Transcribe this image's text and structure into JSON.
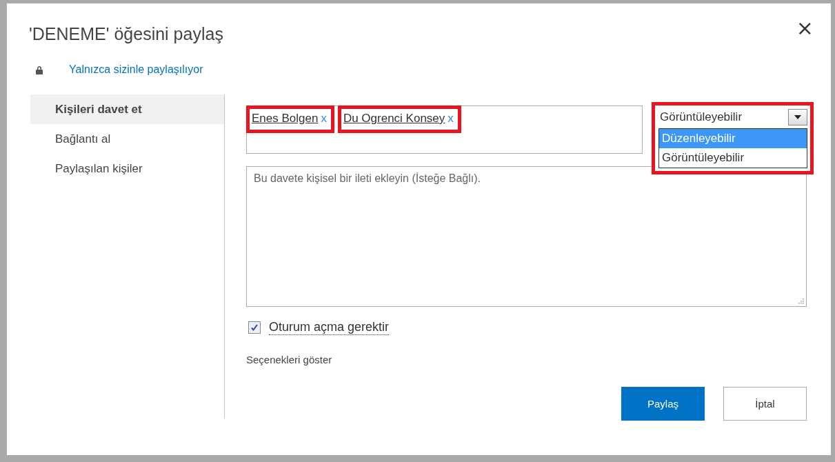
{
  "dialog": {
    "title": "'DENEME' öğesini paylaş",
    "close": "×",
    "sharing_status": "Yalnızca sizinle paylaşılıyor"
  },
  "sidebar": {
    "items": [
      {
        "label": "Kişileri davet et",
        "selected": true
      },
      {
        "label": "Bağlantı al",
        "selected": false
      },
      {
        "label": "Paylaşılan kişiler",
        "selected": false
      }
    ]
  },
  "people": [
    {
      "name": "Enes Bolgen",
      "remove": "x"
    },
    {
      "name": "Du Ogrenci Konsey",
      "remove": "x"
    }
  ],
  "permission": {
    "value": "Görüntüleyebilir",
    "options": [
      {
        "label": "Düzenleyebilir",
        "highlighted": true
      },
      {
        "label": "Görüntüleyebilir",
        "highlighted": false
      }
    ]
  },
  "message": {
    "placeholder": "Bu davete kişisel bir ileti ekleyin (İsteğe Bağlı)."
  },
  "require_signin": {
    "label": "Oturum açma gerektir",
    "checked": true
  },
  "show_options": "Seçenekleri göster",
  "buttons": [
    {
      "label": "Paylaş",
      "kind": "primary"
    },
    {
      "label": "İptal",
      "kind": "secondary"
    }
  ]
}
